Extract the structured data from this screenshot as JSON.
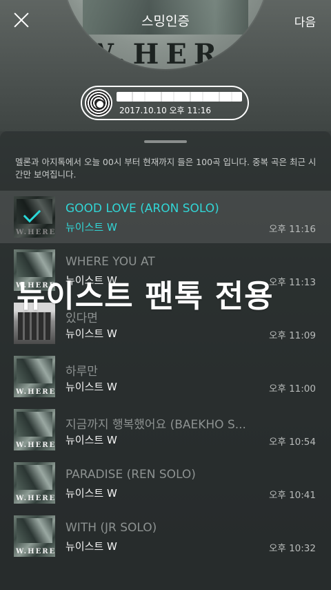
{
  "header": {
    "title": "스밍인증",
    "next_label": "다음",
    "cover_letters": "W.HER",
    "badge_date": "2017.10.10 오후 11:16"
  },
  "info": {
    "text": "멜론과 아지톡에서 오늘 00시 부터 현재까지 들은 100곡 입니다. 중복 곡은 최근 시간만 보여집니다."
  },
  "tracks": [
    {
      "title": "GOOD LOVE (ARON SOLO)",
      "artist": "뉴이스트 W",
      "time": "오후 11:16",
      "thumb_text": "W.HERE",
      "selected": true
    },
    {
      "title": "WHERE YOU AT",
      "artist": "뉴이스트 W",
      "time": "오후 11:13",
      "thumb_text": "W.HERE",
      "selected": false
    },
    {
      "title": "있다면",
      "artist": "뉴이스트 W",
      "time": "오후 11:09",
      "thumb_text": "",
      "selected": false
    },
    {
      "title": "하루만",
      "artist": "뉴이스트 W",
      "time": "오후 11:00",
      "thumb_text": "W.HERE",
      "selected": false
    },
    {
      "title": "지금까지 행복했어요 (BAEKHO S...",
      "artist": "뉴이스트 W",
      "time": "오후 10:54",
      "thumb_text": "W.HERE",
      "selected": false
    },
    {
      "title": "PARADISE (REN SOLO)",
      "artist": "뉴이스트 W",
      "time": "오후 10:41",
      "thumb_text": "W.HERE",
      "selected": false
    },
    {
      "title": "WITH (JR SOLO)",
      "artist": "뉴이스트 W",
      "time": "오후 10:32",
      "thumb_text": "W.HERE",
      "selected": false
    }
  ],
  "overlay": {
    "text": "뉴이스트 팬톡 전용"
  },
  "icons": {
    "close": "close-icon",
    "disc": "disc-icon",
    "check": "check-icon"
  },
  "colors": {
    "accent": "#31d6d6"
  }
}
